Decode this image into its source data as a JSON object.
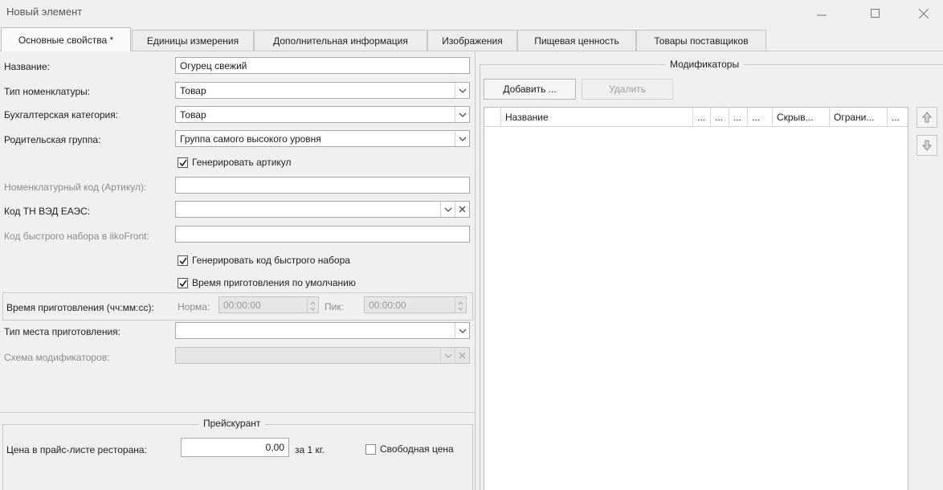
{
  "window": {
    "title": "Новый элемент"
  },
  "tabs": [
    {
      "label": "Основные свойства *"
    },
    {
      "label": "Единицы измерения"
    },
    {
      "label": "Дополнительная информация"
    },
    {
      "label": "Изображения"
    },
    {
      "label": "Пищевая ценность"
    },
    {
      "label": "Товары поставщиков"
    }
  ],
  "form": {
    "name_label": "Название:",
    "name_value": "Огурец свежий",
    "type_label": "Тип номенклатуры:",
    "type_value": "Товар",
    "account_label": "Бухгалтерская категория:",
    "account_value": "Товар",
    "parent_label": "Родительская группа:",
    "parent_value": "Группа самого высокого уровня",
    "gen_article_label": "Генерировать артикул",
    "gen_article_checked": true,
    "article_label": "Номенклатурный код (Артикул):",
    "article_value": "",
    "tnved_label": "Код ТН ВЭД ЕАЭС:",
    "tnved_value": "",
    "fastcode_label": "Код быстрого набора в iikoFront:",
    "fastcode_value": "",
    "gen_fastcode_label": "Генерировать код быстрого набора",
    "gen_fastcode_checked": true,
    "default_cooktime_label": "Время приготовления по умолчанию",
    "default_cooktime_checked": true,
    "cooktime_label": "Время приготовления (чч:мм:сс):",
    "norm_label": "Норма:",
    "norm_value": "00:00:00",
    "peak_label": "Пик:",
    "peak_value": "00:00:00",
    "place_label": "Тип места приготовления:",
    "place_value": "",
    "modscheme_label": "Схема модификаторов:",
    "modscheme_value": ""
  },
  "pricelist": {
    "legend": "Прейскурант",
    "price_label": "Цена в прайс-листе ресторана:",
    "price_value": "0,00",
    "unit_label": "за 1 кг.",
    "free_price_label": "Свободная цена",
    "free_price_checked": false
  },
  "modifiers": {
    "legend": "Модификаторы",
    "add_label": "Добавить ...",
    "delete_label": "Удалить",
    "columns": [
      "Название",
      "...",
      "...",
      "...",
      "...",
      "Скрыв...",
      "Ограни...",
      "..."
    ]
  },
  "icons": {
    "minimize": "minimize-icon",
    "maximize": "maximize-icon",
    "close": "close-icon",
    "dropdown": "chevron-down-icon",
    "clear": "clear-x-icon",
    "check": "check-icon",
    "up": "arrow-up-icon",
    "down": "arrow-down-icon",
    "spinner": "spinner-icon"
  }
}
